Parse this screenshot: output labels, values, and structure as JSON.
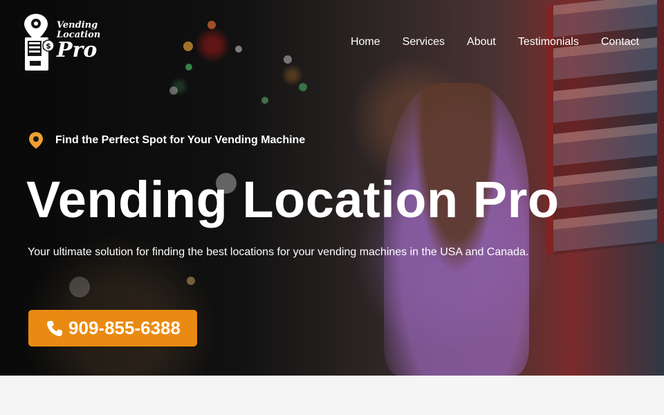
{
  "brand": {
    "line1": "Vending",
    "line2": "Location",
    "line3": "Pro",
    "icon": "vending-machine-location-icon"
  },
  "nav": {
    "items": [
      {
        "label": "Home"
      },
      {
        "label": "Services"
      },
      {
        "label": "About"
      },
      {
        "label": "Testimonials"
      },
      {
        "label": "Contact"
      }
    ]
  },
  "hero": {
    "tagline": "Find the Perfect Spot for Your Vending Machine",
    "tagline_icon": "map-pin-icon",
    "title": "Vending Location Pro",
    "subtitle": "Your ultimate solution for finding the best locations for your vending machines in the USA and Canada.",
    "phone": "909-855-6388",
    "phone_icon": "phone-icon"
  },
  "colors": {
    "accent": "#e98a12",
    "pin": "#f0a030",
    "text": "#ffffff",
    "below_bg": "#f5f5f5"
  }
}
